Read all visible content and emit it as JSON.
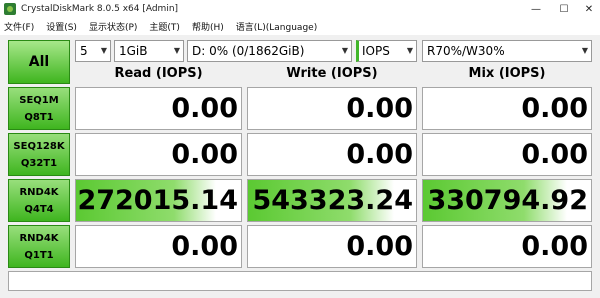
{
  "window": {
    "title": "CrystalDiskMark 8.0.5 x64 [Admin]",
    "controls": {
      "minimize": "—",
      "maximize": "☐",
      "close": "✕"
    }
  },
  "menu": [
    "文件(F)",
    "设置(S)",
    "显示状态(P)",
    "主题(T)",
    "帮助(H)",
    "语言(L)(Language)"
  ],
  "controls": {
    "all_label": "All",
    "count": "5",
    "size": "1GiB",
    "drive": "D: 0% (0/1862GiB)",
    "unit": "IOPS",
    "mix": "R70%/W30%"
  },
  "headers": {
    "read": "Read (IOPS)",
    "write": "Write (IOPS)",
    "mix": "Mix (IOPS)"
  },
  "rows": [
    {
      "line1": "SEQ1M",
      "line2": "Q8T1",
      "read": "0.00",
      "write": "0.00",
      "mix": "0.00"
    },
    {
      "line1": "SEQ128K",
      "line2": "Q32T1",
      "read": "0.00",
      "write": "0.00",
      "mix": "0.00"
    },
    {
      "line1": "RND4K",
      "line2": "Q4T4",
      "read": "272015.14",
      "write": "543323.24",
      "mix": "330794.92"
    },
    {
      "line1": "RND4K",
      "line2": "Q1T1",
      "read": "0.00",
      "write": "0.00",
      "mix": "0.00"
    }
  ],
  "bar_fraction": {
    "rnd4k_q4t4_read": 0.85,
    "rnd4k_q4t4_write": 0.87,
    "rnd4k_q4t4_mix": 0.86
  },
  "comment": "",
  "colors": {
    "accent_green": "#3fb51f",
    "bar_green": "#5bc932"
  }
}
